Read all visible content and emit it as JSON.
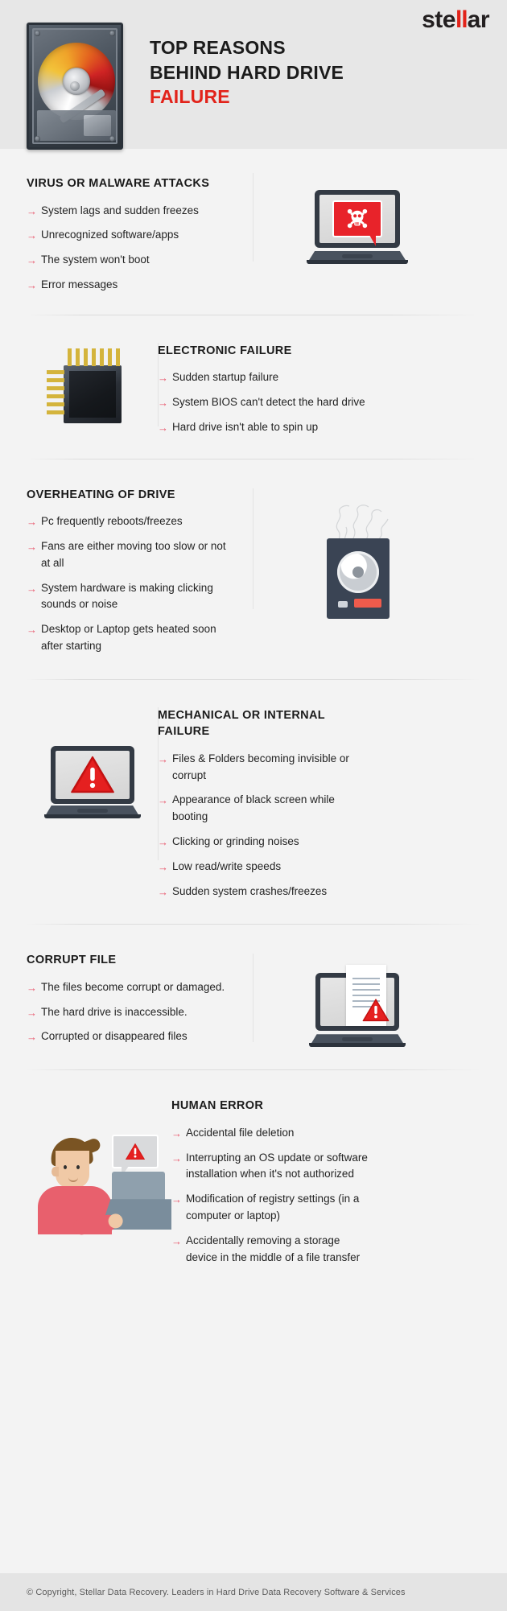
{
  "brand": {
    "prefix": "ste",
    "accent": "ll",
    "suffix": "ar",
    "accent_color": "#e2231a"
  },
  "header": {
    "line1": "TOP REASONS",
    "line2": "BEHIND HARD DRIVE",
    "line3": "FAILURE",
    "hdd_icon": "hard-disk-drive-illustration"
  },
  "sections": [
    {
      "id": "virus",
      "title": "VIRUS OR MALWARE ATTACKS",
      "art": "laptop-with-skull-warning",
      "layout": "text-left",
      "bullets": [
        "System lags and sudden freezes",
        "Unrecognized software/apps",
        "The system won't boot",
        "Error messages"
      ]
    },
    {
      "id": "electronic",
      "title": "ELECTRONIC FAILURE",
      "art": "microchip",
      "layout": "text-right",
      "bullets": [
        "Sudden startup failure",
        "System BIOS can't detect the hard drive",
        "Hard drive isn't able to spin up"
      ]
    },
    {
      "id": "overheating",
      "title": "OVERHEATING OF DRIVE",
      "art": "smoking-hard-drive",
      "layout": "text-left",
      "bullets": [
        "Pc frequently reboots/freezes",
        "Fans are either moving too slow or not at all",
        "System hardware is making clicking sounds or noise",
        "Desktop or Laptop gets heated soon after starting"
      ]
    },
    {
      "id": "mechanical",
      "title": "MECHANICAL OR INTERNAL FAILURE",
      "art": "laptop-with-warning-triangle",
      "layout": "text-right",
      "bullets": [
        "Files & Folders becoming invisible or corrupt",
        "Appearance of black screen while booting",
        "Clicking or grinding noises",
        "Low read/write speeds",
        "Sudden system crashes/freezes"
      ]
    },
    {
      "id": "corrupt",
      "title": "CORRUPT FILE",
      "art": "laptop-with-document-and-warning",
      "layout": "text-left",
      "bullets": [
        "The files become corrupt or damaged.",
        "The hard drive is inaccessible.",
        "Corrupted or disappeared files"
      ]
    },
    {
      "id": "human",
      "title": "HUMAN ERROR",
      "art": "person-at-laptop-with-warning",
      "layout": "text-right",
      "bullets": [
        "Accidental file deletion",
        "Interrupting an OS update or software installation when it's not authorized",
        "Modification of registry settings (in a computer or laptop)",
        "Accidentally removing a storage device in the middle of a file transfer"
      ]
    }
  ],
  "bullet_marker": "→",
  "colors": {
    "accent_red": "#e2231a",
    "bullet_arrow": "#e8556b",
    "page_bg": "#f3f3f3",
    "header_bg": "#e7e7e7",
    "footer_bg": "#e4e4e4"
  },
  "footer": {
    "text": "© Copyright, Stellar Data Recovery. Leaders in Hard Drive Data Recovery Software & Services"
  }
}
